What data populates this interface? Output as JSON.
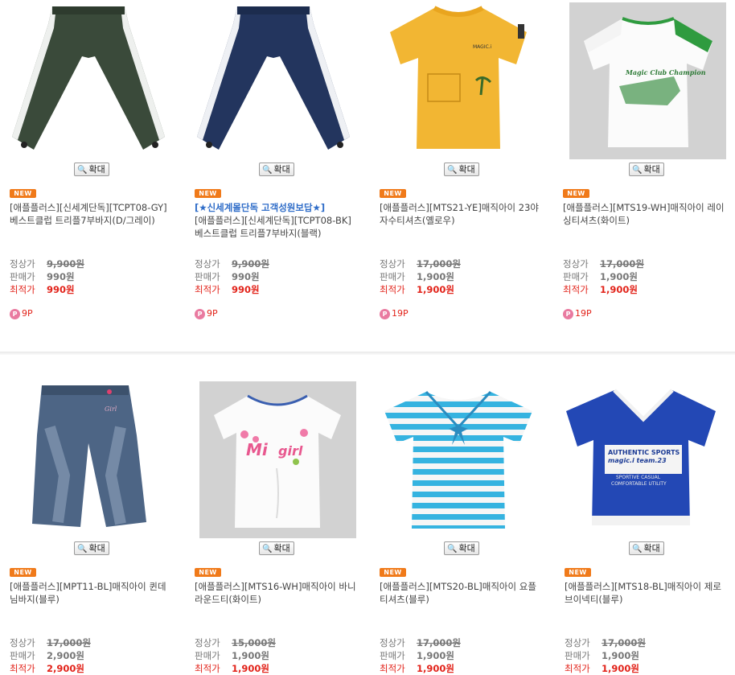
{
  "zoom_label": "확대",
  "new_label": "NEW",
  "price_labels": {
    "list": "정상가",
    "sale": "판매가",
    "best": "최적가"
  },
  "products": [
    {
      "name": "[애플플러스][신세계단독][TCPT08-GY]베스트클럽 트리플7부바지(D/그레이)",
      "promo": "",
      "list_price": "9,900원",
      "sale_price": "990원",
      "best_price": "990원",
      "points": "9P",
      "image": "dark-green-capri-pants"
    },
    {
      "name": "[애플플러스][신세계단독][TCPT08-BK]베스트클럽 트리플7부바지(블랙)",
      "promo": "[★신세계몰단독 고객성원보답★]",
      "list_price": "9,900원",
      "sale_price": "990원",
      "best_price": "990원",
      "points": "9P",
      "image": "navy-capri-pants"
    },
    {
      "name": "[애플플러스][MTS21-YE]매직아이 23야자수티셔츠(옐로우)",
      "promo": "",
      "list_price": "17,000원",
      "sale_price": "1,900원",
      "best_price": "1,900원",
      "points": "19P",
      "image": "yellow-tshirt"
    },
    {
      "name": "[애플플러스][MTS19-WH]매직아이 레이싱티셔츠(화이트)",
      "promo": "",
      "list_price": "17,000원",
      "sale_price": "1,900원",
      "best_price": "1,900원",
      "points": "19P",
      "image": "white-racing-tshirt"
    },
    {
      "name": "[애플플러스][MPT11-BL]매직아이 퀸데님바지(블루)",
      "promo": "",
      "list_price": "17,000원",
      "sale_price": "2,900원",
      "best_price": "2,900원",
      "points": "",
      "image": "denim-capri-jeans"
    },
    {
      "name": "[애플플러스][MTS16-WH]매직아이 바니라운드티(화이트)",
      "promo": "",
      "list_price": "15,000원",
      "sale_price": "1,900원",
      "best_price": "1,900원",
      "points": "",
      "image": "white-mi-girl-tshirt"
    },
    {
      "name": "[애플플러스][MTS20-BL]매직아이 요플티셔츠(블루)",
      "promo": "",
      "list_price": "17,000원",
      "sale_price": "1,900원",
      "best_price": "1,900원",
      "points": "",
      "image": "blue-striped-tshirt"
    },
    {
      "name": "[애플플러스][MTS18-BL]매직아이 제로브이넥티(블루)",
      "promo": "",
      "list_price": "17,000원",
      "sale_price": "1,900원",
      "best_price": "1,900원",
      "points": "",
      "image": "blue-vneck-tshirt"
    }
  ],
  "image_text": {
    "p3": "MAGIC.i",
    "p4": "Magic Club Champion",
    "p5": "Girl",
    "p6_a": "Mi",
    "p6_b": "girl",
    "p8_a": "AUTHENTIC SPORTS",
    "p8_b": "magic.i team.23",
    "p8_c": "SPORTIVE CASUAL",
    "p8_d": "COMFORTABLE UTILITY"
  },
  "colors": {
    "price_red": "#e2231a",
    "new_badge": "#f07a1a",
    "promo_blue": "#2e6cc8",
    "point_pink": "#e97aa0"
  }
}
